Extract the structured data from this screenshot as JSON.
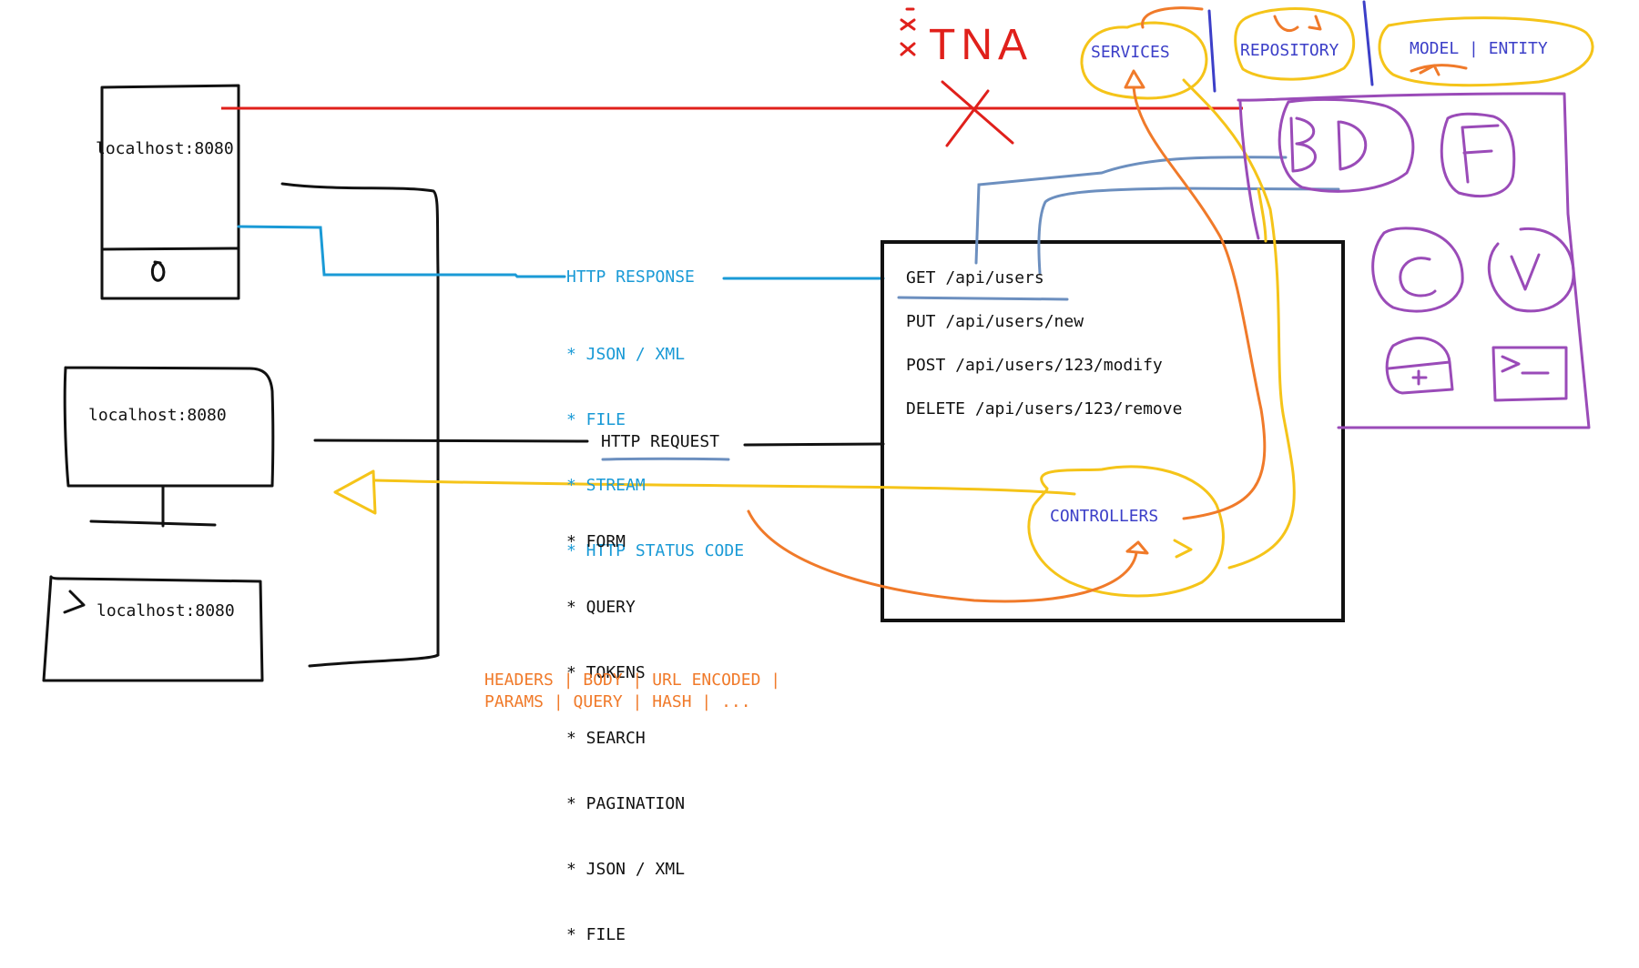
{
  "colors": {
    "black": "#111111",
    "red": "#e0201b",
    "blue": "#1a9ad6",
    "steel": "#6c8fbf",
    "yellow": "#f5c419",
    "orange": "#f07a2a",
    "purple": "#9a4bb8",
    "indigo": "#3c3fc8"
  },
  "devices": {
    "phone_label": "localhost:8080",
    "desktop_label": "localhost:8080",
    "terminal_label": "localhost:8080"
  },
  "response": {
    "title": "HTTP RESPONSE",
    "items": [
      "* JSON / XML",
      "* FILE",
      "* STREAM",
      "* HTTP STATUS CODE"
    ]
  },
  "request": {
    "title": "HTTP REQUEST",
    "items": [
      "* FORM",
      "* QUERY",
      "* TOKENS",
      "* SEARCH",
      "* PAGINATION",
      "* JSON / XML",
      "* FILE"
    ]
  },
  "transport": {
    "line1": "HEADERS | BODY | URL ENCODED |",
    "line2": "PARAMS | QUERY | HASH | ..."
  },
  "endpoints": [
    "GET /api/users",
    "PUT /api/users/new",
    "POST /api/users/123/modify",
    "DELETE /api/users/123/remove"
  ],
  "layers": {
    "controllers": "CONTROLLERS",
    "services": "SERVICES",
    "repository": "REPOSITORY",
    "model": "MODEL | ENTITY"
  },
  "tna": "TNA",
  "resources": {
    "bd": "BD",
    "f": "F",
    "c": "C",
    "v": "V"
  },
  "icons": [
    "power-icon",
    "prompt-icon",
    "lock-icon",
    "terminal-icon",
    "cross-icon"
  ]
}
